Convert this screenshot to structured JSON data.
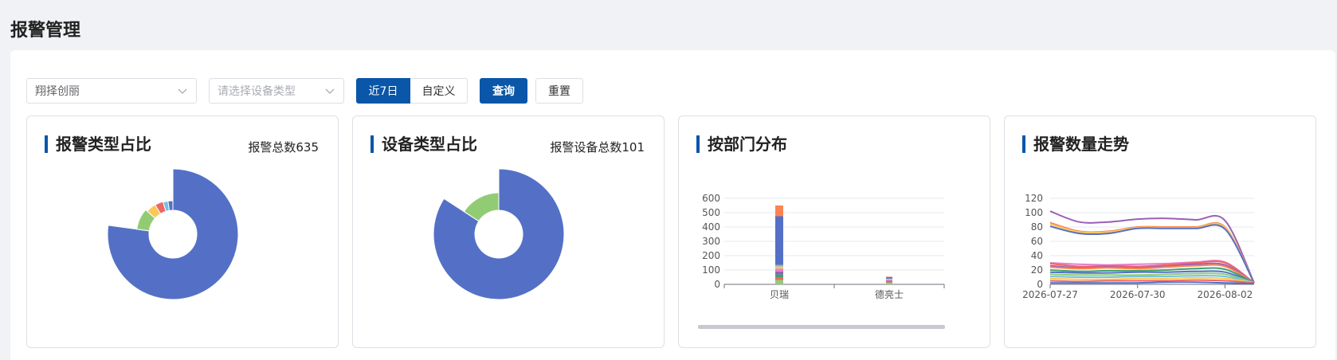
{
  "page": {
    "title": "报警管理"
  },
  "filters": {
    "line_select_value": "翔择创丽",
    "device_type_placeholder": "请选择设备类型",
    "range_tabs": [
      {
        "label": "近7日",
        "active": true
      },
      {
        "label": "自定义",
        "active": false
      }
    ],
    "query_label": "查询",
    "reset_label": "重置"
  },
  "cards": {
    "alarm_type": {
      "title": "报警类型占比",
      "total_label": "报警总数635"
    },
    "device_type": {
      "title": "设备类型占比",
      "total_label": "报警设备总数101"
    },
    "department": {
      "title": "按部门分布"
    },
    "trend": {
      "title": "报警数量走势"
    }
  },
  "colors": {
    "primary": "#0a56a8",
    "blue": "#5470c6",
    "green": "#91cc75",
    "yellow": "#fac858",
    "red": "#ee6666",
    "cyan": "#73c0de",
    "orange": "#fc8452",
    "purple": "#9a60b4"
  },
  "chart_data": [
    {
      "type": "pie",
      "subtype": "rose-donut",
      "slices": [
        {
          "value": 490,
          "color": "#5470c6"
        },
        {
          "value": 60,
          "color": "#91cc75"
        },
        {
          "value": 30,
          "color": "#fac858"
        },
        {
          "value": 25,
          "color": "#ee6666"
        },
        {
          "value": 15,
          "color": "#73c0de"
        },
        {
          "value": 15,
          "color": "#5470c6"
        }
      ]
    },
    {
      "type": "pie",
      "subtype": "rose-donut",
      "slices": [
        {
          "value": 85,
          "color": "#5470c6"
        },
        {
          "value": 16,
          "color": "#91cc75"
        }
      ]
    },
    {
      "type": "bar",
      "stacked": true,
      "categories": [
        "贝瑞",
        "德亮士"
      ],
      "ylim": [
        0,
        600
      ],
      "yticks": [
        0,
        100,
        200,
        300,
        400,
        500,
        600
      ],
      "series": [
        {
          "color": "#91cc75",
          "values": [
            30,
            10
          ]
        },
        {
          "color": "#ee6666",
          "values": [
            20,
            5
          ]
        },
        {
          "color": "#3ba272",
          "values": [
            20,
            5
          ]
        },
        {
          "color": "#9a60b4",
          "values": [
            20,
            5
          ]
        },
        {
          "color": "#ea7ccc",
          "values": [
            20,
            5
          ]
        },
        {
          "color": "#fac858",
          "values": [
            15,
            5
          ]
        },
        {
          "color": "#73c0de",
          "values": [
            10,
            5
          ]
        },
        {
          "color": "#5470c6",
          "values": [
            340,
            10
          ]
        },
        {
          "color": "#fc8452",
          "values": [
            75,
            3
          ]
        }
      ],
      "grid": true
    },
    {
      "type": "line",
      "smooth": true,
      "xticks": [
        "2026-07-27",
        "2026-07-30",
        "2026-08-02"
      ],
      "ylim": [
        0,
        120
      ],
      "yticks": [
        0,
        20,
        40,
        60,
        80,
        100,
        120
      ],
      "grid": true,
      "series": [
        {
          "color": "#9a60b4",
          "values": [
            102,
            87,
            87,
            91,
            92,
            90,
            89,
            2
          ]
        },
        {
          "color": "#fc8452",
          "values": [
            86,
            74,
            74,
            80,
            80,
            80,
            80,
            2
          ]
        },
        {
          "color": "#fac858",
          "values": [
            84,
            73,
            73,
            79,
            79,
            79,
            79,
            2
          ]
        },
        {
          "color": "#5470c6",
          "values": [
            81,
            71,
            71,
            78,
            78,
            78,
            77,
            2
          ]
        },
        {
          "color": "#ea7ccc",
          "values": [
            30,
            28,
            27,
            28,
            29,
            31,
            31,
            2
          ]
        },
        {
          "color": "#ee6666",
          "values": [
            29,
            25,
            26,
            25,
            27,
            30,
            30,
            2
          ]
        },
        {
          "color": "#9a60b4",
          "values": [
            26,
            23,
            24,
            23,
            25,
            28,
            27,
            2
          ]
        },
        {
          "color": "#fc8452",
          "values": [
            24,
            22,
            23,
            22,
            24,
            26,
            25,
            2
          ]
        },
        {
          "color": "#3ba272",
          "values": [
            20,
            18,
            19,
            19,
            20,
            22,
            21,
            2
          ]
        },
        {
          "color": "#5470c6",
          "values": [
            17,
            16,
            16,
            17,
            17,
            18,
            17,
            2
          ]
        },
        {
          "color": "#91cc75",
          "values": [
            14,
            13,
            13,
            13,
            14,
            15,
            14,
            2
          ]
        },
        {
          "color": "#73c0de",
          "values": [
            11,
            10,
            10,
            11,
            11,
            12,
            11,
            2
          ]
        },
        {
          "color": "#fac858",
          "values": [
            8,
            7,
            7,
            8,
            8,
            9,
            8,
            2
          ]
        },
        {
          "color": "#ee6666",
          "values": [
            5,
            4,
            5,
            5,
            5,
            6,
            5,
            2
          ]
        },
        {
          "color": "#5470c6",
          "values": [
            2,
            2,
            2,
            2,
            3,
            3,
            2,
            1
          ]
        }
      ]
    }
  ]
}
